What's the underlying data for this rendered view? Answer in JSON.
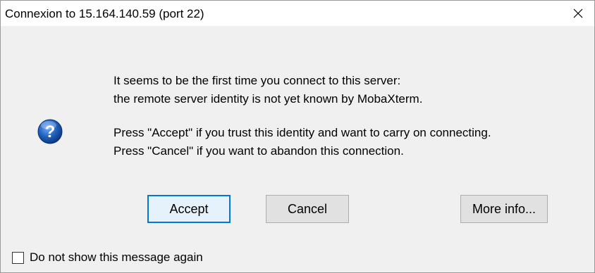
{
  "window": {
    "title": "Connexion to 15.164.140.59 (port 22)"
  },
  "icon": {
    "semantic": "question-icon",
    "accent": "#1f5fb8"
  },
  "message": {
    "line1": "It seems to be the first time you connect to this server:",
    "line2": "the remote server identity is not yet known by MobaXterm.",
    "line3": "Press \"Accept\" if you trust this identity and want to carry on connecting.",
    "line4": "Press \"Cancel\" if you want to abandon this connection."
  },
  "buttons": {
    "accept": "Accept",
    "cancel": "Cancel",
    "more_info": "More info..."
  },
  "checkbox": {
    "label": "Do not show this message again",
    "checked": false
  },
  "colors": {
    "focus_border": "#0078d7",
    "dialog_bg": "#f0f0f0"
  }
}
